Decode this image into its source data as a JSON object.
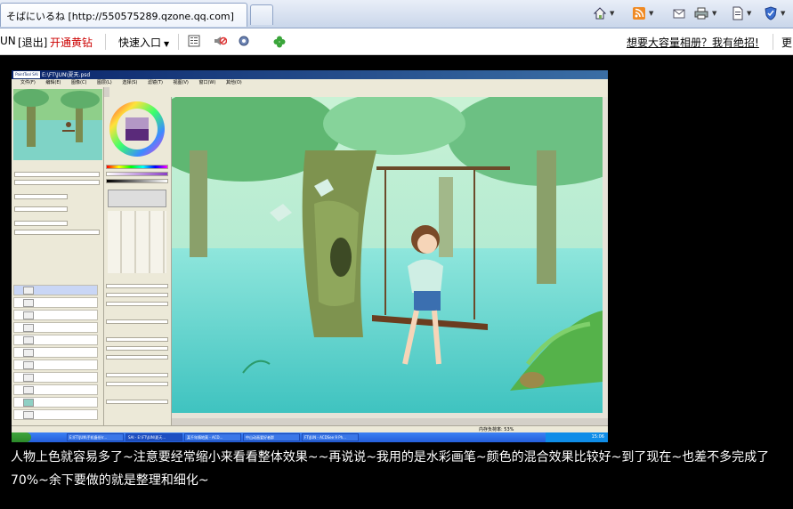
{
  "browser": {
    "tab_title": "そばにいるね [http://550575289.qzone.qq.com]",
    "icons": [
      "home-icon",
      "rss-icon",
      "mail-icon",
      "print-icon",
      "page-icon",
      "safety-icon"
    ]
  },
  "qzone_bar": {
    "user_fragment": "UN",
    "logout": "[退出]",
    "open_vip": "开通黄钻",
    "quick_entry": "快速入口",
    "album_promo": "想要大容量相册？我有绝招!",
    "more": "更"
  },
  "screenshot": {
    "app_logo": "PaintTool SAI",
    "window_title": "E:\\FT\\JUN\\夏天.psd",
    "menu": [
      "文件(F)",
      "编辑(E)",
      "图像(C)",
      "图层(L)",
      "选择(S)",
      "滤镜(T)",
      "视图(V)",
      "窗口(W)",
      "其他(O)"
    ],
    "taskbar_items": [
      "E:\\FT\\JUN\\手机备份\\r...",
      "SAI - E:\\FT\\JUN\\夏天...",
      "某千年情地莫 - ACD...",
      "中山动画爱好者群",
      "FT\\JUN - ACDSee 9 Ph..."
    ],
    "status_text": "内存负荷率: 53%",
    "clock": "15:06"
  },
  "caption": "人物上色就容易多了~注意要经常缩小来看看整体效果~~再说说~我用的是水彩画笔~颜色的混合效果比较好~到了现在~也差不多完成了70%~余下要做的就是整理和细化~",
  "colors": {
    "page_bg": "#000000",
    "vip_red": "#cc0000",
    "caption_text": "#ffffff"
  }
}
